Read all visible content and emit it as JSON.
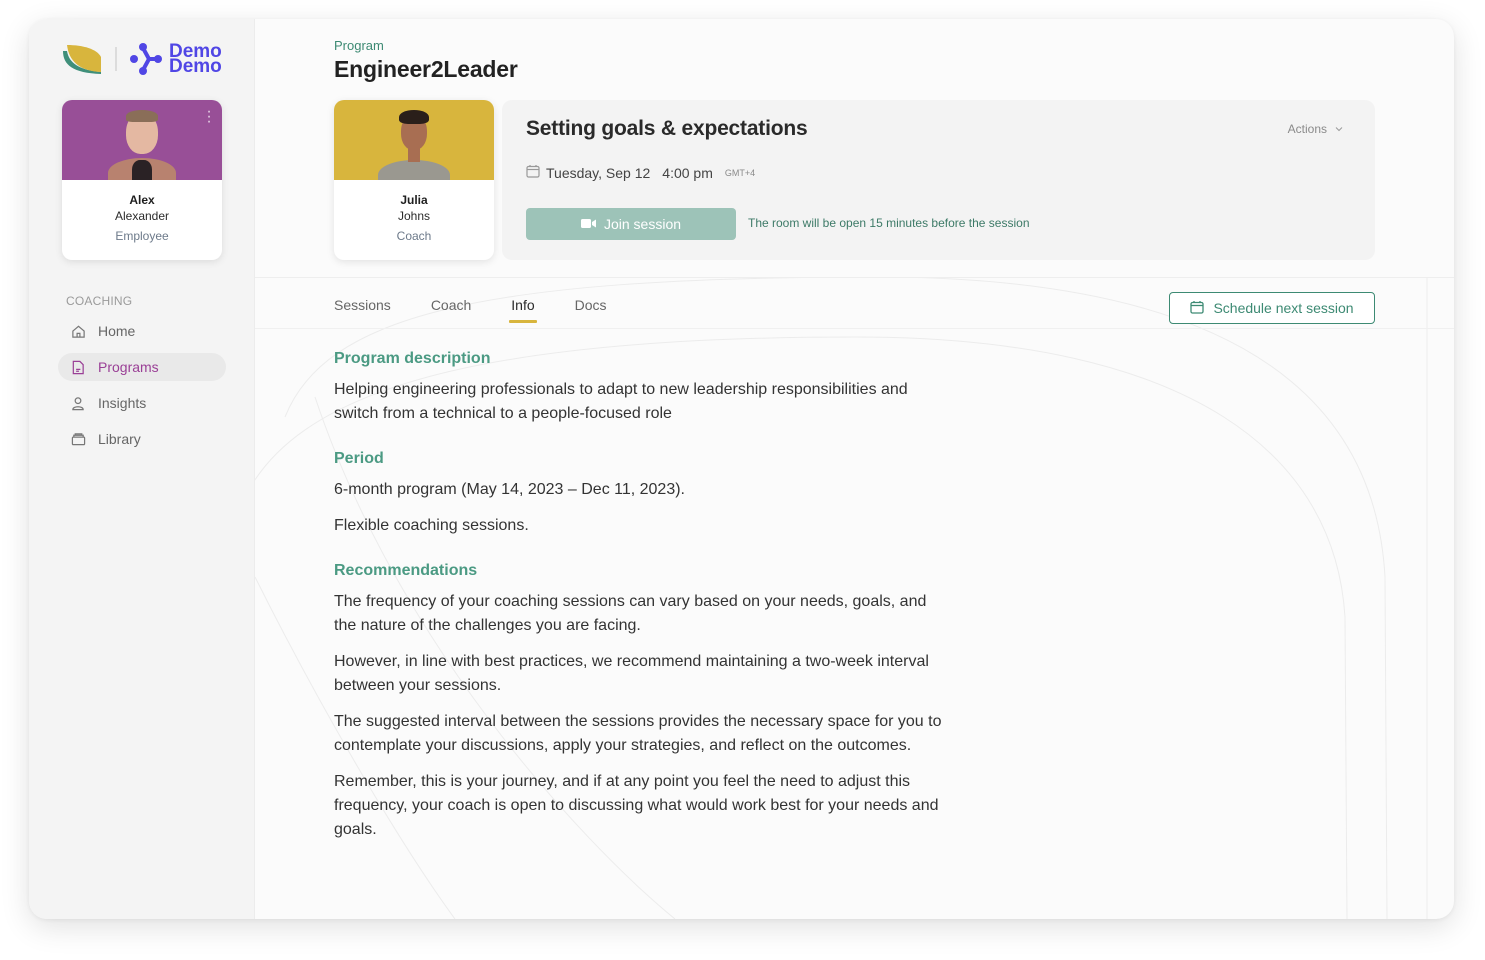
{
  "brand": {
    "partner_logo": "leaf-logo",
    "name_line1": "Demo",
    "name_line2": "Demo",
    "color": "#5046e5"
  },
  "user": {
    "first_name": "Alex",
    "last_name": "Alexander",
    "role": "Employee",
    "photo_bg": "#984f97"
  },
  "sidebar": {
    "section_label": "COACHING",
    "items": [
      {
        "label": "Home",
        "icon": "home-icon",
        "active": false
      },
      {
        "label": "Programs",
        "icon": "document-icon",
        "active": true
      },
      {
        "label": "Insights",
        "icon": "user-icon",
        "active": false
      },
      {
        "label": "Library",
        "icon": "archive-icon",
        "active": false
      }
    ]
  },
  "program": {
    "eyebrow": "Program",
    "title": "Engineer2Leader"
  },
  "coach": {
    "first_name": "Julia",
    "last_name": "Johns",
    "role": "Coach",
    "photo_bg": "#d8b53d"
  },
  "session": {
    "title": "Setting goals & expectations",
    "actions_label": "Actions",
    "date": "Tuesday, Sep 12",
    "time": "4:00 pm",
    "timezone": "GMT+4",
    "join_label": "Join session",
    "room_note": "The room will be open 15 minutes before the session"
  },
  "tabs": [
    {
      "label": "Sessions",
      "active": false
    },
    {
      "label": "Coach",
      "active": false
    },
    {
      "label": "Info",
      "active": true
    },
    {
      "label": "Docs",
      "active": false
    }
  ],
  "schedule_button": "Schedule next session",
  "info": {
    "description": {
      "heading": "Program description",
      "text": "Helping engineering professionals to adapt to new leadership responsibilities and switch from a technical to a people-focused role"
    },
    "period": {
      "heading": "Period",
      "paragraphs": [
        "6-month program (May 14, 2023 – Dec 11, 2023).",
        "Flexible coaching sessions."
      ]
    },
    "recommendations": {
      "heading": "Recommendations",
      "paragraphs": [
        "The frequency of your coaching sessions can vary based on your needs, goals, and the nature of the challenges you are facing.",
        "However, in line with best practices, we recommend maintaining a two-week interval between your sessions.",
        "The suggested interval between the sessions provides the necessary space for you to contemplate your discussions, apply your strategies, and reflect on the outcomes.",
        "Remember, this is your journey, and if at any point you feel the need to adjust this frequency, your coach is open to discussing what would work best for your needs and goals."
      ]
    }
  },
  "colors": {
    "accent_green": "#3d8a73",
    "heading_green": "#4b9a83",
    "tab_underline": "#d8b53d",
    "active_nav": "#9a3f96",
    "join_button": "#9dc3b8"
  }
}
